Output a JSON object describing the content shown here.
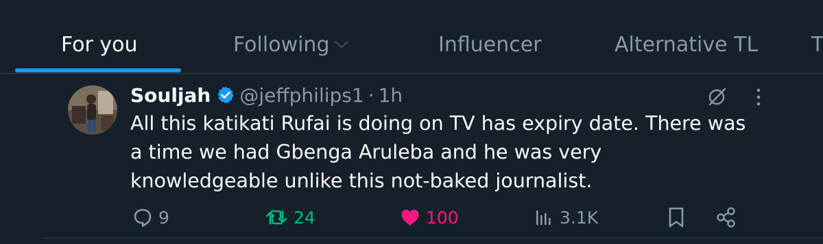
{
  "tabs": [
    {
      "label": "For you",
      "active": true
    },
    {
      "label": "Following",
      "active": false
    },
    {
      "label": "Influencer",
      "active": false
    },
    {
      "label": "Alternative TL",
      "active": false
    },
    {
      "label": "T",
      "active": false
    }
  ],
  "tweet": {
    "display_name": "Souljah",
    "verified": true,
    "handle": "@jeffphilips1",
    "separator": "·",
    "time": "1h",
    "text_lines": [
      "All this katikati Rufai is doing on TV has expiry date. There was",
      "a time we had Gbenga Aruleba and he was very",
      "knowledgeable unlike this not-baked journalist."
    ],
    "stats": {
      "replies": "9",
      "retweets": "24",
      "likes": "100",
      "views": "3.1K"
    },
    "liked": true,
    "retweeted": true
  },
  "colors": {
    "background": "#15202b",
    "accent": "#1d9bf0",
    "retweet": "#00ba7c",
    "like": "#f91880",
    "muted": "#8b98a5"
  }
}
